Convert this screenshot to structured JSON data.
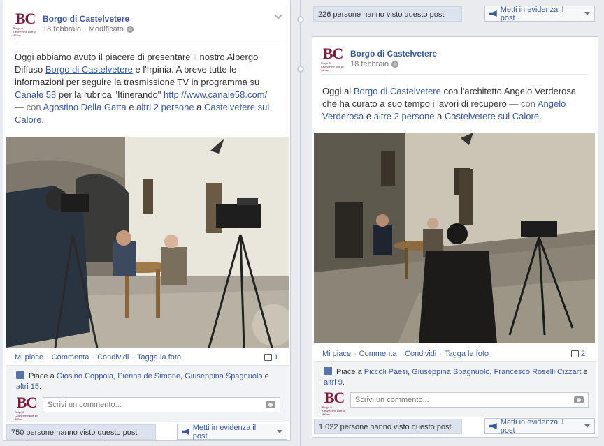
{
  "page_name": "Borgo di Castelvetere",
  "logo": {
    "initials": "BC",
    "subtitle": "Borgo di Castelvetere albergo diffuso"
  },
  "top_right_bar": {
    "views": "226 persone hanno visto questo post",
    "promote": "Metti in evidenza il post"
  },
  "post1": {
    "author": "Borgo di Castelvetere",
    "date": "18 febbraio",
    "modified": "· Modificato",
    "text_intro": "Oggi abbiamo avuto il piacere di presentare il nostro Albergo Diffuso ",
    "link_borgo": "Borgo di Castelvetere",
    "text_mid": " e l'Irpinia. A breve tutte le informazioni per seguire la trasmissione TV in programma su ",
    "link_canale": "Canale 58",
    "text_mid2": " per la rubrica \"Itinerando\" ",
    "link_url": "http://www.canale58.com/",
    "with_prefix": "— con ",
    "tag_person": "Agostino Della Gatta",
    "and": " e ",
    "tag_others": "altri 2 persone",
    "at": " a ",
    "place": "Castelvetere sul Calore.",
    "actions": {
      "like": "Mi piace",
      "comment": "Commenta",
      "share": "Condividi",
      "tag": "Tagga la foto"
    },
    "comment_count": "1",
    "likes_prefix": "Piace a ",
    "likers": [
      "Giosino Coppola",
      "Pierina de Simone",
      "Giuseppina Spagnuolo"
    ],
    "likes_and": " e ",
    "likes_more": "altri 15",
    "comment_placeholder": "Scrivi un commento...",
    "views": "750 persone hanno visto questo post",
    "promote": "Metti in evidenza il post"
  },
  "post2": {
    "author": "Borgo di Castelvetere",
    "date": "18 febbraio",
    "text_intro": "Oggi al ",
    "link_borgo": "Borgo di Castelvetere",
    "text_mid": " con l'architetto Angelo Verderosa che ha curato a suo tempo i lavori di recupero ",
    "with_prefix": "— con ",
    "tag_person": "Angelo Verderosa",
    "and": " e ",
    "tag_others": "altre 2 persone",
    "at": " a ",
    "place": "Castelvetere sul Calore.",
    "actions": {
      "like": "Mi piace",
      "comment": "Commenta",
      "share": "Condividi",
      "tag": "Tagga la foto"
    },
    "comment_count": "2",
    "likes_prefix": "Piace a ",
    "likers": [
      "Piccoli Paesi",
      "Giuseppina Spagnuolo",
      "Francesco Roselli Cizzart"
    ],
    "likes_and": " e ",
    "likes_more": "altri 9",
    "comment_placeholder": "Scrivi un commento...",
    "views": "1.022 persone hanno visto questo post",
    "promote": "Metti in evidenza il post"
  }
}
